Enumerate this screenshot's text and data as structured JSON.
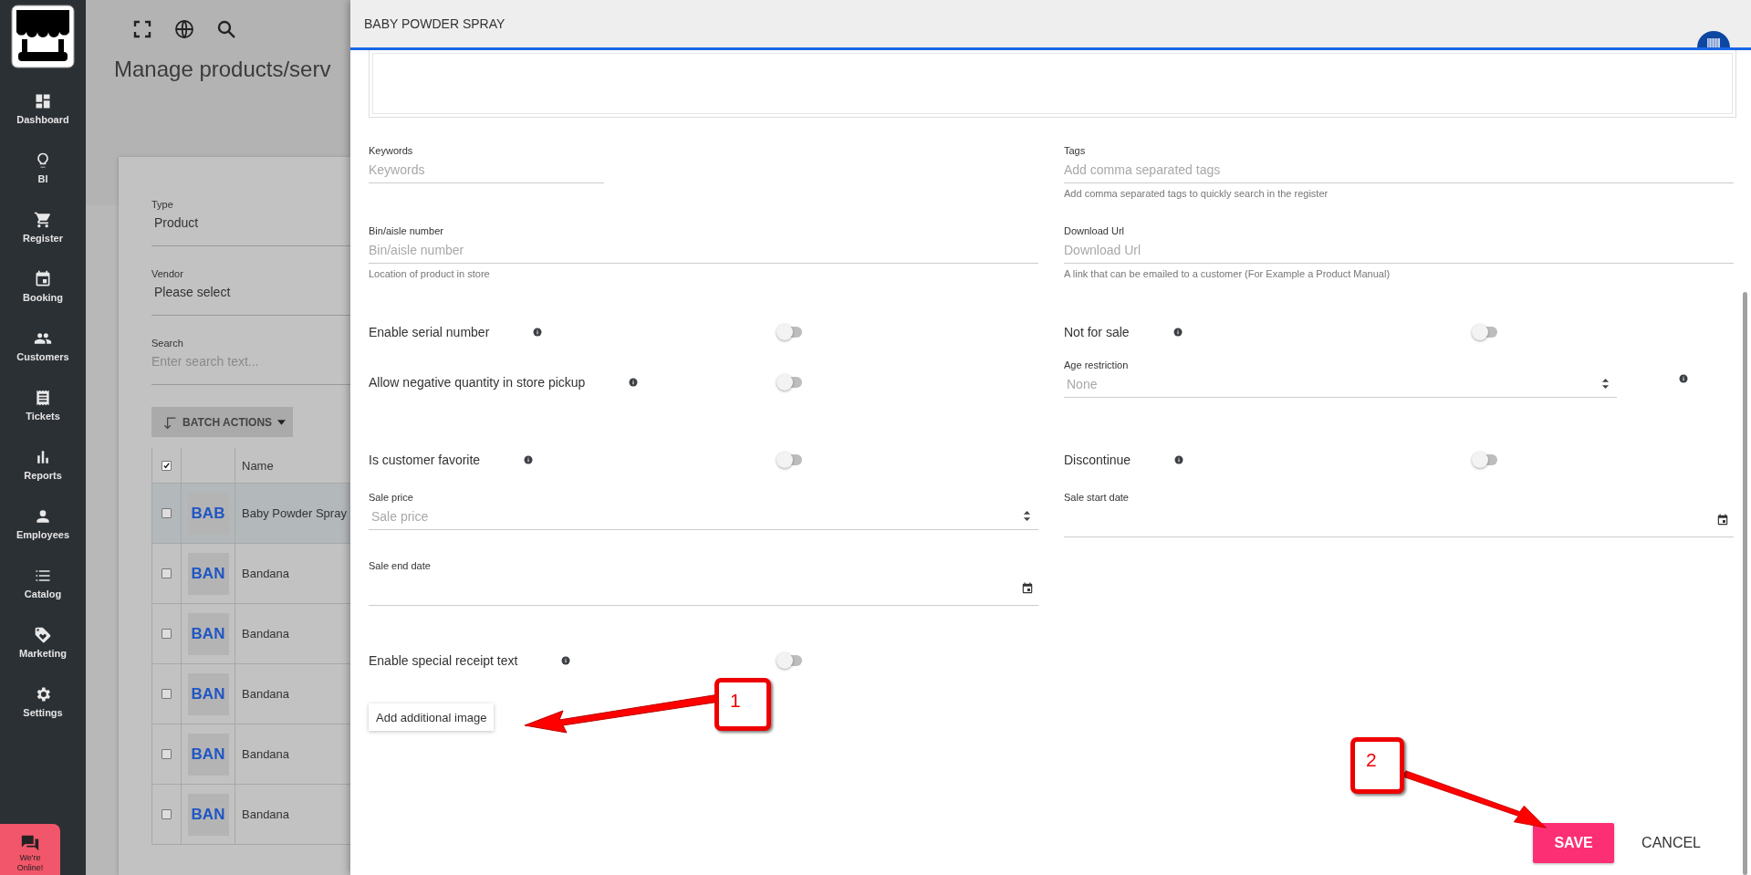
{
  "sidebar": {
    "items": [
      {
        "label": "Dashboard"
      },
      {
        "label": "BI"
      },
      {
        "label": "Register"
      },
      {
        "label": "Booking"
      },
      {
        "label": "Customers"
      },
      {
        "label": "Tickets"
      },
      {
        "label": "Reports"
      },
      {
        "label": "Employees"
      },
      {
        "label": "Catalog"
      },
      {
        "label": "Marketing"
      },
      {
        "label": "Settings"
      }
    ],
    "chat_badge": {
      "label": "We're Online!"
    }
  },
  "page": {
    "title": "Manage products/serv",
    "filters": [
      {
        "label": "Type",
        "value": "Product"
      },
      {
        "label": "Vendor",
        "value": "Please select"
      },
      {
        "label": "Search",
        "placeholder": "Enter search text..."
      }
    ],
    "batch_button": "BATCH ACTIONS",
    "table": {
      "select_all_checked": true,
      "columns": [
        "Name"
      ],
      "rows": [
        {
          "thumb": "BAB",
          "name": "Baby Powder Spray",
          "selected": true,
          "checked": false
        },
        {
          "thumb": "BAN",
          "name": "Bandana",
          "selected": false,
          "checked": false
        },
        {
          "thumb": "BAN",
          "name": "Bandana",
          "selected": false,
          "checked": false
        },
        {
          "thumb": "BAN",
          "name": "Bandana",
          "selected": false,
          "checked": false
        },
        {
          "thumb": "BAN",
          "name": "Bandana",
          "selected": false,
          "checked": false
        },
        {
          "thumb": "BAN",
          "name": "Bandana",
          "selected": false,
          "checked": false
        }
      ]
    }
  },
  "dialog": {
    "title": "BABY POWDER SPRAY",
    "rows": [
      {
        "left": {
          "kind": "text",
          "label": "Keywords",
          "placeholder": "Keywords"
        },
        "right": {
          "kind": "text",
          "label": "Tags",
          "placeholder": "Add comma separated tags",
          "hint": "Add comma separated tags to quickly search in the register"
        }
      },
      {
        "left": {
          "kind": "text",
          "label": "Bin/aisle number",
          "placeholder": "Bin/aisle number",
          "hint": "Location of product in store"
        },
        "right": {
          "kind": "text",
          "label": "Download Url",
          "placeholder": "Download Url",
          "hint": "A link that can be emailed to a customer (For Example a Product Manual)"
        }
      },
      {
        "left": {
          "kind": "toggle",
          "label": "Enable serial number",
          "info": true,
          "on": false
        },
        "right": {
          "kind": "toggle",
          "label": "Not for sale",
          "info": true,
          "on": false
        }
      },
      {
        "left": {
          "kind": "toggle",
          "label": "Allow negative quantity in store pickup",
          "info": true,
          "on": false
        },
        "right": {
          "kind": "select",
          "label": "Age restriction",
          "placeholder": "None",
          "info": true
        }
      },
      {
        "left": {
          "kind": "toggle",
          "label": "Is customer favorite",
          "info": true,
          "on": false
        },
        "right": {
          "kind": "toggle",
          "label": "Discontinue",
          "info": true,
          "on": false
        }
      },
      {
        "left": {
          "kind": "number",
          "label": "Sale price",
          "placeholder": "Sale price"
        },
        "right": {
          "kind": "date",
          "label": "Sale start date"
        }
      },
      {
        "left": {
          "kind": "date",
          "label": "Sale end date"
        }
      },
      {
        "left": {
          "kind": "toggle",
          "label": "Enable special receipt text",
          "info": true,
          "on": false
        }
      }
    ],
    "add_image_button": "Add additional image",
    "actions": [
      {
        "label": "SAVE",
        "kind": "primary"
      },
      {
        "label": "CANCEL",
        "kind": "flat"
      }
    ]
  },
  "annotations": [
    {
      "label": "1"
    },
    {
      "label": "2"
    }
  ]
}
